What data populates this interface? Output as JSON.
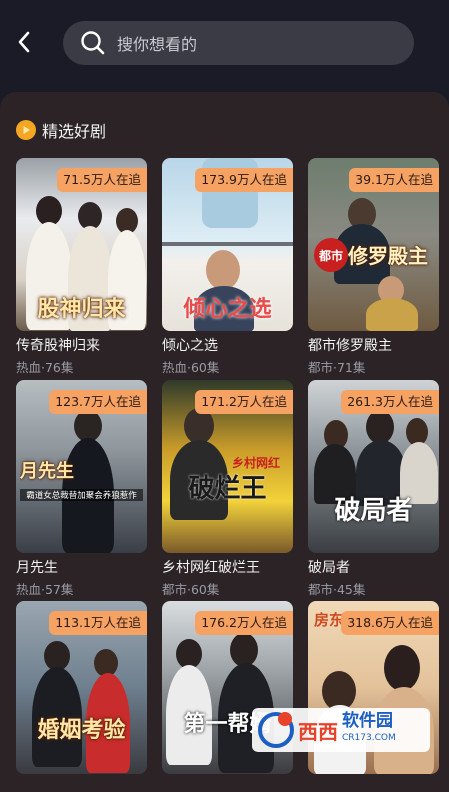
{
  "header": {
    "back_icon": "chevron-left-icon",
    "search_placeholder": "搜你想看的",
    "search_icon": "search-icon"
  },
  "section": {
    "title": "精选好剧",
    "icon": "play-coin-icon"
  },
  "dramas": [
    {
      "badge": "71.5万人在追",
      "title": "传奇股神归来",
      "meta": "热血·76集",
      "poster_text": "股神归来"
    },
    {
      "badge": "173.9万人在追",
      "title": "倾心之选",
      "meta": "热血·60集",
      "poster_text": "倾心之选"
    },
    {
      "badge": "39.1万人在追",
      "title": "都市修罗殿主",
      "meta": "都市·71集",
      "poster_text": "修罗殿主",
      "poster_tag": "都市"
    },
    {
      "badge": "123.7万人在追",
      "title": "月先生",
      "meta": "热血·57集",
      "poster_text": "月先生",
      "poster_sub": "霸道女总裁替加聚会养狼惹作"
    },
    {
      "badge": "171.2万人在追",
      "title": "乡村网红破烂王",
      "meta": "都市·60集",
      "poster_text": "破烂王",
      "poster_tag": "乡村网红"
    },
    {
      "badge": "261.3万人在追",
      "title": "破局者",
      "meta": "都市·45集",
      "poster_text": "破局者"
    },
    {
      "badge": "113.1万人在追",
      "title": "",
      "meta": "",
      "poster_text": "婚姻考验"
    },
    {
      "badge": "176.2万人在追",
      "title": "",
      "meta": "",
      "poster_text": "第一帮婿"
    },
    {
      "badge": "318.6万人在追",
      "title": "",
      "meta": "",
      "poster_text": "房东"
    }
  ],
  "watermark": {
    "brand": "西西",
    "site": "软件园",
    "domain": "CR173.COM"
  },
  "colors": {
    "background": "#1a1b26",
    "panel": "#2b2326",
    "badge": "#f6a263",
    "section_icon": "#f5a623"
  }
}
